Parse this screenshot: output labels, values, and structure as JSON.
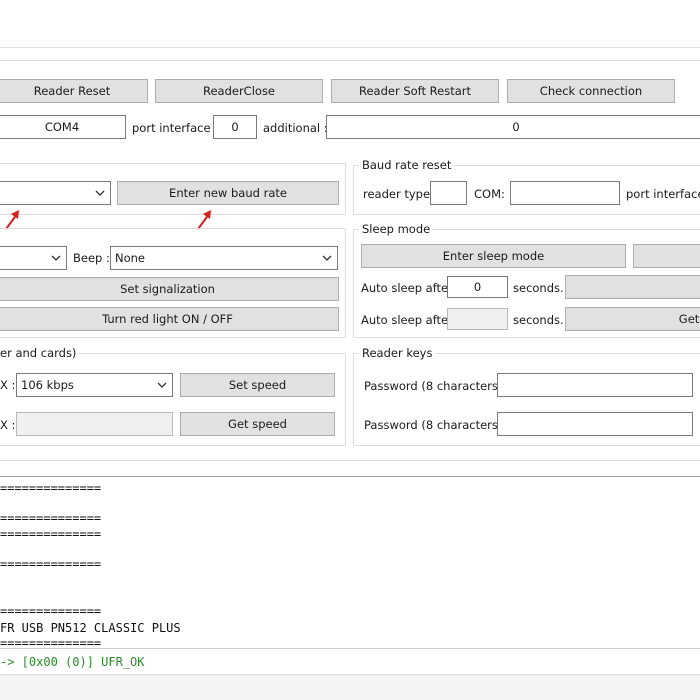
{
  "toolbar": {
    "reader_reset": "Reader Reset",
    "reader_close": "ReaderClose",
    "reader_soft_restart": "Reader Soft Restart",
    "check_connection": "Check connection"
  },
  "connection": {
    "com_value": "COM4",
    "port_interface_label": "port interface :",
    "port_interface_value": "0",
    "additional_label": "additional :",
    "additional_value": "0"
  },
  "baud": {
    "enter_new_baud_rate": "Enter new baud rate"
  },
  "baud_reset": {
    "title": "Baud rate reset",
    "reader_type_label": "reader type",
    "reader_type_value": "",
    "com_label": "COM:",
    "com_value": "",
    "port_interface_label": "port interface:"
  },
  "signal": {
    "beep_label": "Beep :",
    "beep_value": "None",
    "set_signalization": "Set signalization",
    "turn_red_light": "Turn red light ON / OFF"
  },
  "sleep": {
    "title": "Sleep mode",
    "enter_sleep_mode": "Enter sleep mode",
    "auto_sleep_label_1": "Auto sleep after",
    "auto_sleep_value_1": "0",
    "seconds_1": "seconds.",
    "set_partial": "S",
    "auto_sleep_label_2": "Auto sleep after",
    "auto_sleep_value_2": "",
    "seconds_2": "seconds.",
    "get_partial": "Get a"
  },
  "speed": {
    "title": "er and cards)",
    "tx_label": "X :",
    "tx_value": "106 kbps",
    "set_speed": "Set speed",
    "rx_label": "X :",
    "rx_value": "",
    "get_speed": "Get speed"
  },
  "keys": {
    "title": "Reader keys",
    "password_label_1": "Password (8 characters) :",
    "password_value_1": "",
    "password_label_2": "Password (8 characters) :",
    "password_value_2": ""
  },
  "console": {
    "lines": [
      "==============",
      "==============",
      "==============",
      "==============",
      "==============",
      "FR USB PN512 CLASSIC PLUS",
      "=============="
    ]
  },
  "status": {
    "text": "-> [0x00 (0)] UFR_OK"
  },
  "colors": {
    "arrow": "#d62020",
    "status_ok": "#2e8b2e",
    "button_bg": "#e1e1e1"
  }
}
